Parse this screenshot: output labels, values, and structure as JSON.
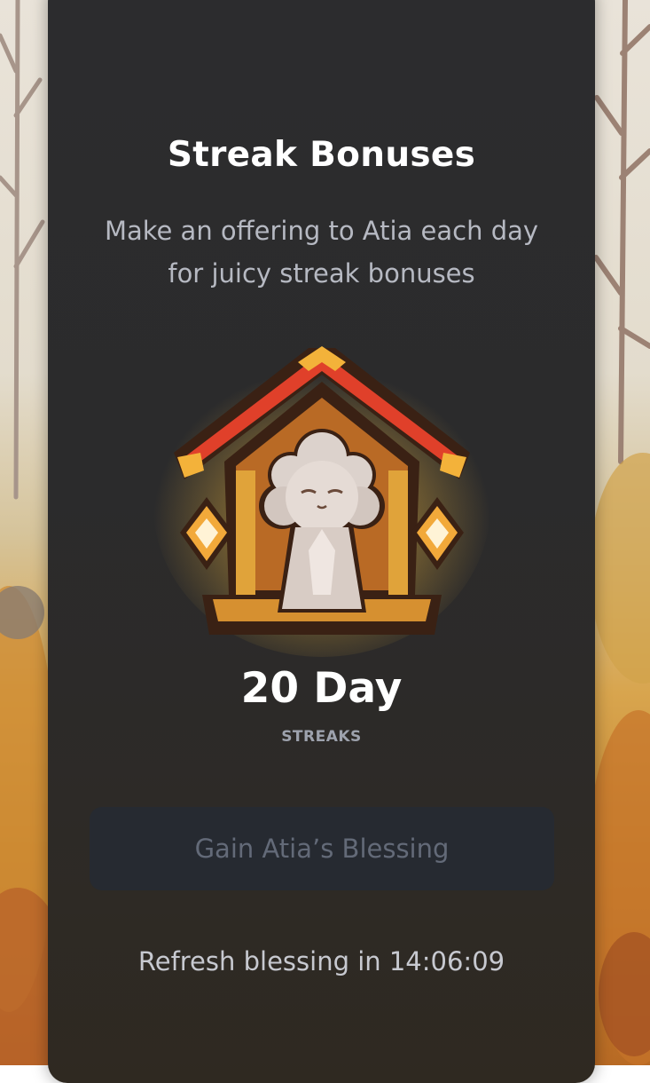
{
  "modal": {
    "title": "Streak Bonuses",
    "description": "Make an offering to Atia each day for juicy streak bonuses",
    "streak_count": "20 Day",
    "streak_label": "STREAKS",
    "action_button_label": "Gain Atia’s Blessing",
    "refresh_prefix": "Refresh blessing in",
    "refresh_timer": "14:06:09"
  },
  "icons": {
    "shrine": "shrine-icon",
    "sparkle": "sparkle-icon"
  },
  "colors": {
    "card_background": "#2c2c2e",
    "button_background": "#262a31",
    "button_text_disabled": "#636a78",
    "roof_red": "#e0402a",
    "wood_orange": "#c7711f",
    "glow_gold": "#f4c04a"
  }
}
